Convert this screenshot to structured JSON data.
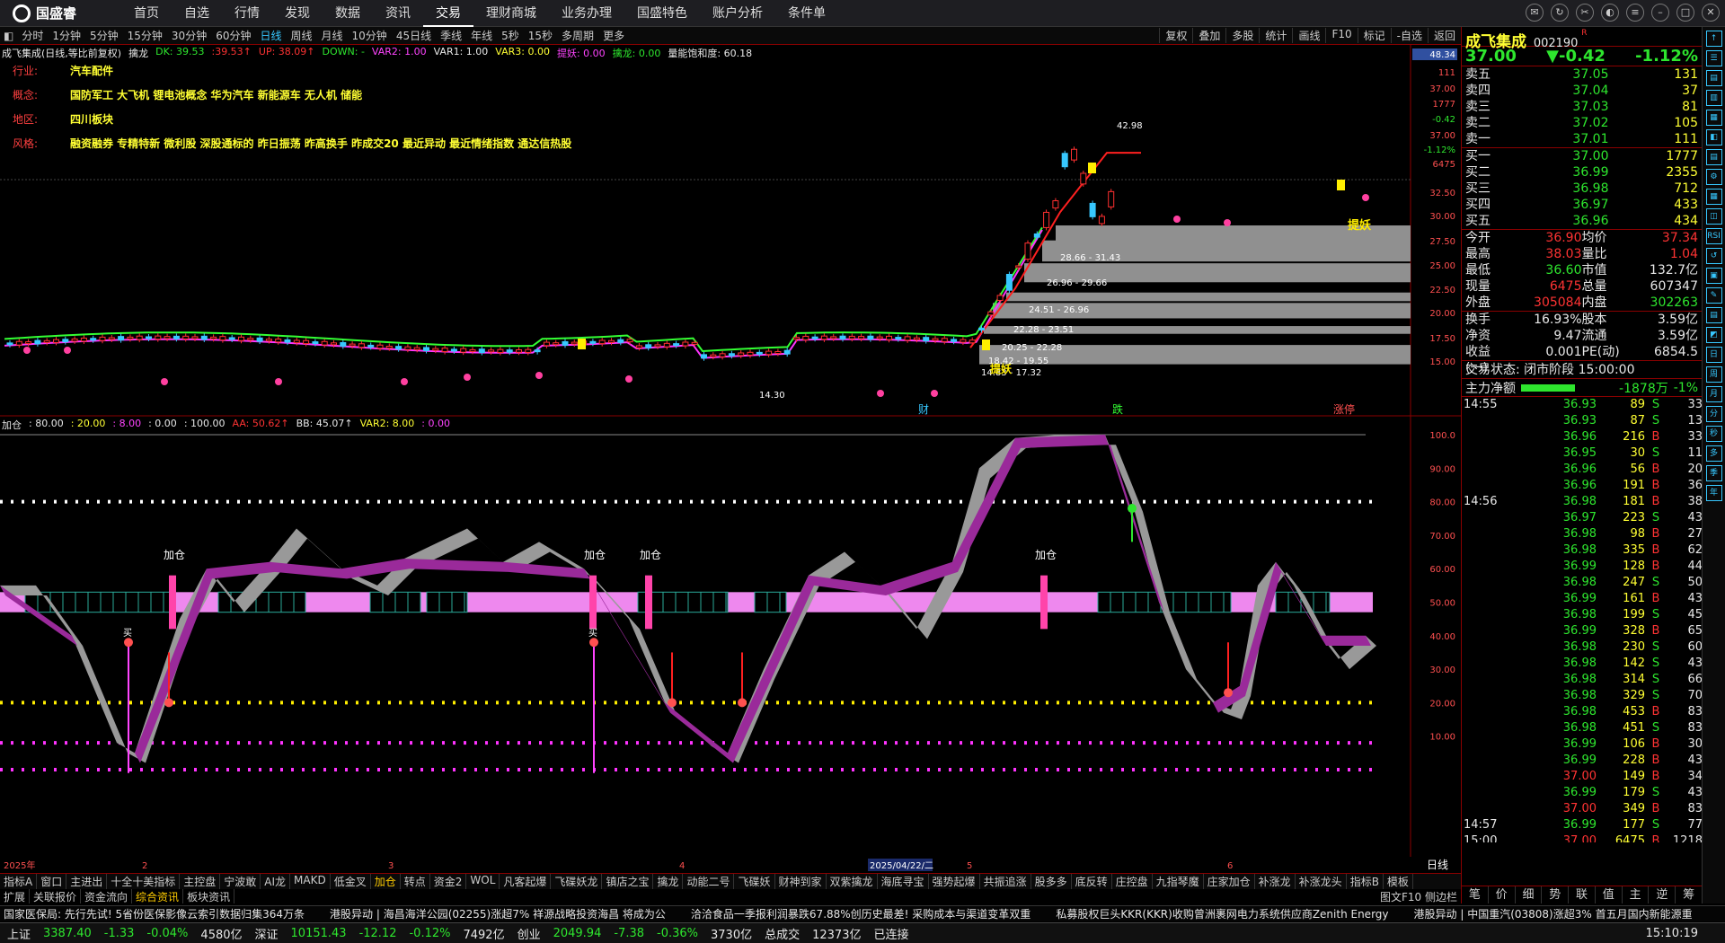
{
  "nav": {
    "brand": "国盛睿",
    "items": [
      "首页",
      "自选",
      "行情",
      "发现",
      "数据",
      "资讯",
      "交易",
      "理财商城",
      "业务办理",
      "国盛特色",
      "账户分析",
      "条件单"
    ]
  },
  "periods": [
    "分时",
    "1分钟",
    "5分钟",
    "15分钟",
    "30分钟",
    "60分钟",
    "日线",
    "周线",
    "月线",
    "10分钟",
    "45日线",
    "季线",
    "年线",
    "5秒",
    "15秒",
    "多周期",
    "更多"
  ],
  "active_period": "日线",
  "rtools": [
    "复权",
    "叠加",
    "多股",
    "统计",
    "画线",
    "F10",
    "标记",
    "-自选",
    "返回"
  ],
  "main_header": [
    {
      "t": "成飞集成(日线,等比前复权)",
      "c": "w"
    },
    {
      "t": "擒龙",
      "c": "w"
    },
    {
      "t": "DK: 39.53",
      "c": "g"
    },
    {
      "t": ":39.53↑",
      "c": "r"
    },
    {
      "t": "UP: 38.09↑",
      "c": "r"
    },
    {
      "t": "DOWN: -",
      "c": "g"
    },
    {
      "t": "VAR2: 1.00",
      "c": "m"
    },
    {
      "t": "VAR1: 1.00",
      "c": "w"
    },
    {
      "t": "VAR3: 0.00",
      "c": "y"
    },
    {
      "t": "提妖: 0.00",
      "c": "m"
    },
    {
      "t": "擒龙: 0.00",
      "c": "g"
    },
    {
      "t": "量能饱和度: 60.18",
      "c": "w"
    }
  ],
  "info": [
    {
      "label": "行业:",
      "value": "汽车配件"
    },
    {
      "label": "概念:",
      "value": "国防军工 大飞机 锂电池概念 华为汽车 新能源车 无人机 储能"
    },
    {
      "label": "地区:",
      "value": "四川板块"
    },
    {
      "label": "风格:",
      "value": "融资融券 专精特新 微利股 深股通标的 昨日振荡 昨高换手 昨成交20 最近异动 最近情绪指数 通达信热股"
    }
  ],
  "price_axis": [
    "48.34",
    "111",
    "37.00",
    "1777",
    "-0.42",
    "37.00",
    "-1.12%",
    "6475",
    "32.50",
    "30.00",
    "27.50",
    "25.00",
    "22.50",
    "20.00",
    "17.50",
    "15.00"
  ],
  "chip_labels": [
    "28.66 - 31.43",
    "26.96 - 29.66",
    "24.51 - 26.96",
    "22.28 - 23.51",
    "20.25 - 22.28",
    "18.42 - 19.55",
    "14.83 - 17.32"
  ],
  "main_annotations": {
    "high": "42.98",
    "low": "14.30",
    "tiyao": "提妖",
    "cai": "财",
    "die": "跌",
    "zhangting": "涨停"
  },
  "ind2_header": [
    {
      "t": "加仓",
      "c": "w"
    },
    {
      "t": ": 80.00",
      "c": "w"
    },
    {
      "t": ": 20.00",
      "c": "y"
    },
    {
      "t": ": 8.00",
      "c": "m"
    },
    {
      "t": ": 0.00",
      "c": "w"
    },
    {
      "t": ": 100.00",
      "c": "w"
    },
    {
      "t": "AA: 50.62↑",
      "c": "r"
    },
    {
      "t": "BB: 45.07↑",
      "c": "w"
    },
    {
      "t": "VAR2: 8.00",
      "c": "y"
    },
    {
      "t": ": 0.00",
      "c": "m"
    }
  ],
  "ind2_axis": [
    "100.0",
    "90.00",
    "80.00",
    "70.00",
    "60.00",
    "50.00",
    "40.00",
    "30.00",
    "20.00",
    "10.00"
  ],
  "ind2_labels": {
    "jiacang": "加仓",
    "mai": "买"
  },
  "date_axis": [
    "2025年",
    "2",
    "3",
    "4",
    "2025/04/22/二",
    "5",
    "6"
  ],
  "period_tag": "日线",
  "tabs": [
    "指标A",
    "窗口",
    "主进出",
    "十全十美指标",
    "主控盘",
    "宁波敢",
    "AI龙",
    "MAKD",
    "低金叉",
    "加仓",
    "转点",
    "资金2",
    "WOL",
    "凡客起爆",
    "飞碟妖龙",
    "镇店之宝",
    "擒龙",
    "动能二号",
    "飞碟妖",
    "财神到家",
    "双紫擒龙",
    "海底寻宝",
    "强势起爆",
    "共振追涨",
    "股多多",
    "底反转",
    "庄控盘",
    "九指琴魔",
    "庄家加仓",
    "补涨龙",
    "补涨龙头",
    "指标B",
    "模板"
  ],
  "active_tab": "加仓",
  "tabs2": [
    "扩展",
    "关联报价",
    "资金流向",
    "综合资讯",
    "板块资讯"
  ],
  "active_tab2": "综合资讯",
  "tabs2_right": "图文F10 侧边栏",
  "ticker": [
    "国家医保局: 先行先试! 5省份医保影像云索引数据归集364万条",
    "港股异动 | 海昌海洋公园(02255)涨超7% 祥源战略投资海昌 将成为公",
    "洽洽食品一季报利润暴跌67.88%创历史最差! 采购成本与渠道变革双重",
    "私募股权巨头KKR(KKR)收购曾洲裹网电力系统供应商Zenith Energy",
    "港股异动 | 中国重汽(03808)涨超3% 首五月国内新能源重"
  ],
  "status": [
    {
      "name": "上证",
      "v1": "3387.40",
      "v2": "-1.33",
      "v3": "-0.04%",
      "v4": "4580亿"
    },
    {
      "name": "深证",
      "v1": "10151.43",
      "v2": "-12.12",
      "v3": "-0.12%",
      "v4": "7492亿"
    },
    {
      "name": "创业",
      "v1": "2049.94",
      "v2": "-7.38",
      "v3": "-0.36%",
      "v4": "3730亿"
    }
  ],
  "status_extra": {
    "label": "总成交",
    "value": "12373亿",
    "conn": "已连接",
    "time": "15:10:19"
  },
  "quote": {
    "name": "成飞集成",
    "code": "002190",
    "flag": "R",
    "price": "37.00",
    "chg": "▼-0.42",
    "pct": "-1.12%"
  },
  "asks": [
    {
      "l": "卖五",
      "p": "37.05",
      "v": "131"
    },
    {
      "l": "卖四",
      "p": "37.04",
      "v": "37"
    },
    {
      "l": "卖三",
      "p": "37.03",
      "v": "81"
    },
    {
      "l": "卖二",
      "p": "37.02",
      "v": "105"
    },
    {
      "l": "卖一",
      "p": "37.01",
      "v": "111"
    }
  ],
  "bids": [
    {
      "l": "买一",
      "p": "37.00",
      "v": "1777"
    },
    {
      "l": "买二",
      "p": "36.99",
      "v": "2355"
    },
    {
      "l": "买三",
      "p": "36.98",
      "v": "712"
    },
    {
      "l": "买四",
      "p": "36.97",
      "v": "433"
    },
    {
      "l": "买五",
      "p": "36.96",
      "v": "434"
    }
  ],
  "stats": [
    [
      {
        "l": "今开",
        "v": "36.90",
        "c": "r"
      },
      {
        "l": "均价",
        "v": "37.34",
        "c": "r"
      }
    ],
    [
      {
        "l": "最高",
        "v": "38.03",
        "c": "r"
      },
      {
        "l": "量比",
        "v": "1.04",
        "c": "r"
      }
    ],
    [
      {
        "l": "最低",
        "v": "36.60",
        "c": "g"
      },
      {
        "l": "市值",
        "v": "132.7亿",
        "c": "w"
      }
    ],
    [
      {
        "l": "现量",
        "v": "6475",
        "c": "r"
      },
      {
        "l": "总量",
        "v": "607347",
        "c": "w"
      }
    ],
    [
      {
        "l": "外盘",
        "v": "305084",
        "c": "r"
      },
      {
        "l": "内盘",
        "v": "302263",
        "c": "g"
      }
    ]
  ],
  "stats2": [
    [
      {
        "l": "换手",
        "v": "16.93%",
        "c": "w"
      },
      {
        "l": "股本",
        "v": "3.59亿",
        "c": "w"
      }
    ],
    [
      {
        "l": "净资",
        "v": "9.47",
        "c": "w"
      },
      {
        "l": "流通",
        "v": "3.59亿",
        "c": "w"
      }
    ],
    [
      {
        "l": "收益(一)",
        "v": "0.001",
        "c": "w"
      },
      {
        "l": "PE(动)",
        "v": "6854.5",
        "c": "w"
      }
    ]
  ],
  "trade_state": "交易状态: 闭市阶段 15:00:00",
  "main_flow": {
    "label": "主力净额",
    "value": "-1878万",
    "pct": "-1%"
  },
  "trades": [
    {
      "t": "14:55",
      "p": "36.93",
      "v": "89",
      "s": "S",
      "n": "33"
    },
    {
      "t": "",
      "p": "36.93",
      "v": "87",
      "s": "S",
      "n": "13"
    },
    {
      "t": "",
      "p": "36.96",
      "v": "216",
      "s": "B",
      "n": "33"
    },
    {
      "t": "",
      "p": "36.95",
      "v": "30",
      "s": "S",
      "n": "11"
    },
    {
      "t": "",
      "p": "36.96",
      "v": "56",
      "s": "B",
      "n": "20"
    },
    {
      "t": "",
      "p": "36.96",
      "v": "191",
      "s": "B",
      "n": "36"
    },
    {
      "t": "14:56",
      "p": "36.98",
      "v": "181",
      "s": "B",
      "n": "38"
    },
    {
      "t": "",
      "p": "36.97",
      "v": "223",
      "s": "S",
      "n": "43"
    },
    {
      "t": "",
      "p": "36.98",
      "v": "98",
      "s": "B",
      "n": "27"
    },
    {
      "t": "",
      "p": "36.98",
      "v": "335",
      "s": "B",
      "n": "62"
    },
    {
      "t": "",
      "p": "36.99",
      "v": "128",
      "s": "B",
      "n": "44"
    },
    {
      "t": "",
      "p": "36.98",
      "v": "247",
      "s": "S",
      "n": "50"
    },
    {
      "t": "",
      "p": "36.99",
      "v": "161",
      "s": "B",
      "n": "43"
    },
    {
      "t": "",
      "p": "36.98",
      "v": "199",
      "s": "S",
      "n": "45"
    },
    {
      "t": "",
      "p": "36.99",
      "v": "328",
      "s": "B",
      "n": "65"
    },
    {
      "t": "",
      "p": "36.98",
      "v": "230",
      "s": "S",
      "n": "60"
    },
    {
      "t": "",
      "p": "36.98",
      "v": "142",
      "s": "S",
      "n": "43"
    },
    {
      "t": "",
      "p": "36.98",
      "v": "314",
      "s": "S",
      "n": "66"
    },
    {
      "t": "",
      "p": "36.98",
      "v": "329",
      "s": "S",
      "n": "70"
    },
    {
      "t": "",
      "p": "36.98",
      "v": "453",
      "s": "B",
      "n": "83"
    },
    {
      "t": "",
      "p": "36.98",
      "v": "451",
      "s": "S",
      "n": "83"
    },
    {
      "t": "",
      "p": "36.99",
      "v": "106",
      "s": "B",
      "n": "30"
    },
    {
      "t": "",
      "p": "36.99",
      "v": "228",
      "s": "B",
      "n": "43"
    },
    {
      "t": "",
      "p": "37.00",
      "v": "149",
      "s": "B",
      "n": "34"
    },
    {
      "t": "",
      "p": "36.99",
      "v": "179",
      "s": "S",
      "n": "43"
    },
    {
      "t": "",
      "p": "37.00",
      "v": "349",
      "s": "B",
      "n": "83"
    },
    {
      "t": "14:57",
      "p": "36.99",
      "v": "177",
      "s": "S",
      "n": "77"
    },
    {
      "t": "15:00",
      "p": "37.00",
      "v": "6475",
      "s": "B",
      "n": "1218"
    }
  ],
  "rp_tabs": [
    "笔",
    "价",
    "细",
    "势",
    "联",
    "值",
    "主",
    "逆",
    "筹"
  ],
  "sidebar": [
    "↑",
    "☰",
    "▤",
    "▥",
    "▦",
    "◧",
    "▤",
    "⚙",
    "▦",
    "◫",
    "RSI",
    "↺",
    "▣",
    "✎",
    "▤",
    "◩",
    "日",
    "周",
    "月",
    "分",
    "秒",
    "多",
    "季",
    "年"
  ]
}
